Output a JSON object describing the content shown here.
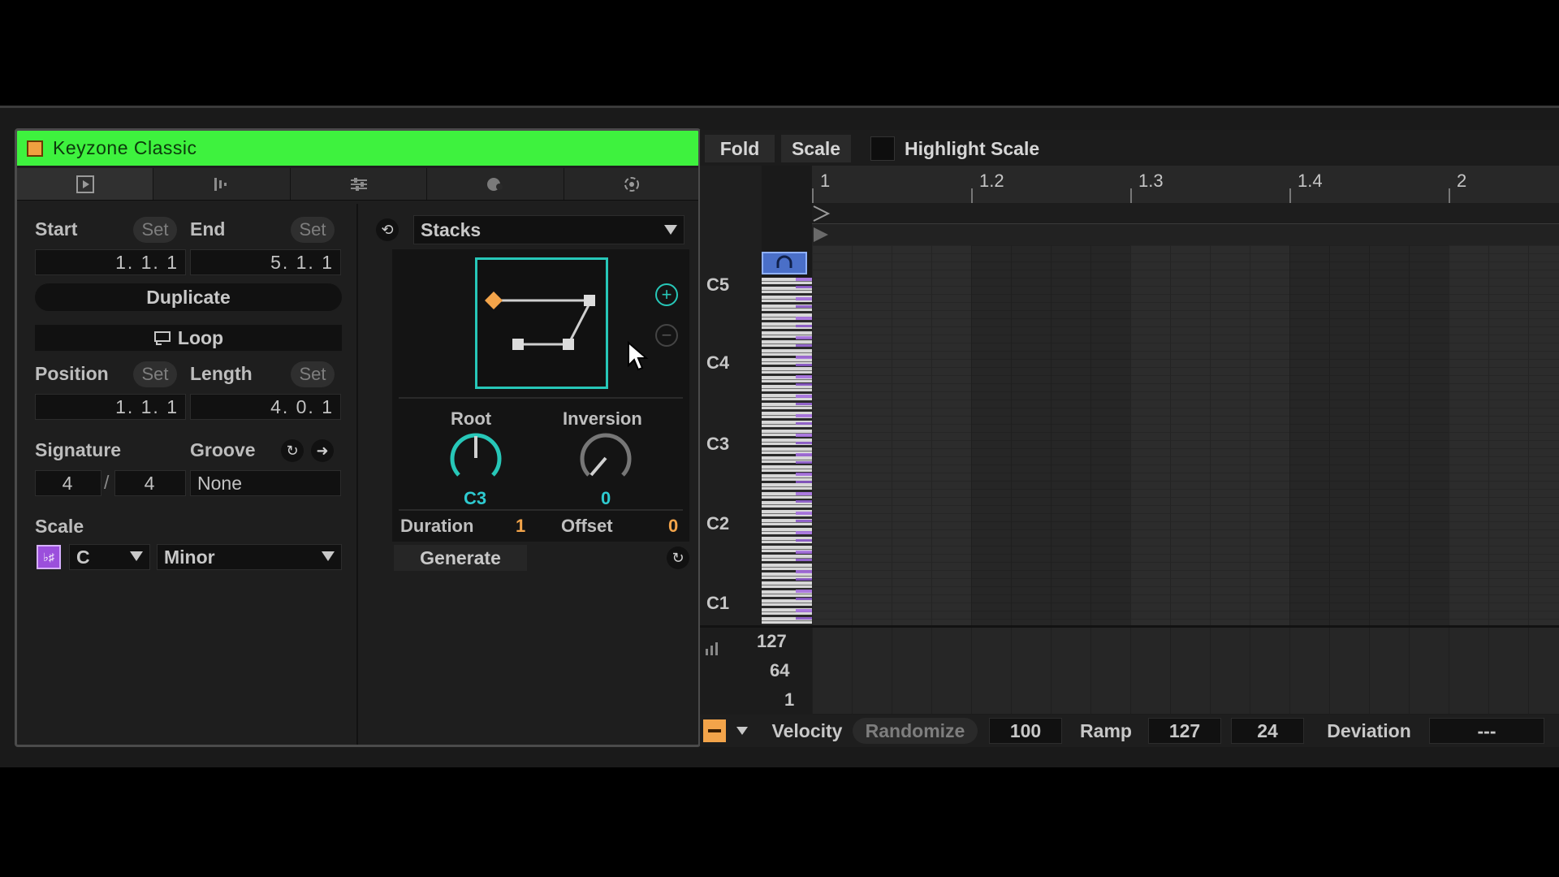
{
  "clip": {
    "title": "Keyzone Classic",
    "color": "#3ef23e",
    "tabs": [
      "clip-tab",
      "notes-tab",
      "envelopes-tab",
      "transform-tab",
      "generate-tab"
    ]
  },
  "clip_panel": {
    "start_label": "Start",
    "end_label": "End",
    "set_label": "Set",
    "start_value": "1.   1.   1",
    "end_value": "5.   1.   1",
    "duplicate_label": "Duplicate",
    "loop_label": "Loop",
    "position_label": "Position",
    "length_label": "Length",
    "position_value": "1.   1.   1",
    "length_value": "4.   0.   1",
    "signature_label": "Signature",
    "groove_label": "Groove",
    "sig_numerator": "4",
    "sig_slash": "/",
    "sig_denominator": "4",
    "groove_value": "None",
    "scale_label": "Scale",
    "scale_root": "C",
    "scale_mode": "Minor"
  },
  "generator": {
    "type": "Stacks",
    "root_label": "Root",
    "root_value": "C3",
    "inversion_label": "Inversion",
    "inversion_value": "0",
    "duration_label": "Duration",
    "duration_value": "1",
    "offset_label": "Offset",
    "offset_value": "0",
    "generate_label": "Generate"
  },
  "editor_toolbar": {
    "fold_label": "Fold",
    "scale_label": "Scale",
    "highlight_label": "Highlight Scale"
  },
  "ruler": {
    "marks": [
      "1",
      "1.2",
      "1.3",
      "1.4",
      "2"
    ]
  },
  "keys": {
    "labels": [
      "C5",
      "C4",
      "C3",
      "C2",
      "C1"
    ]
  },
  "velocity_lane": {
    "ticks": [
      "127",
      "64",
      "1"
    ]
  },
  "bottom_bar": {
    "velocity_label": "Velocity",
    "randomize_label": "Randomize",
    "velocity_value": "100",
    "ramp_label": "Ramp",
    "ramp_start": "127",
    "ramp_end": "24",
    "deviation_label": "Deviation",
    "deviation_value": "---"
  }
}
